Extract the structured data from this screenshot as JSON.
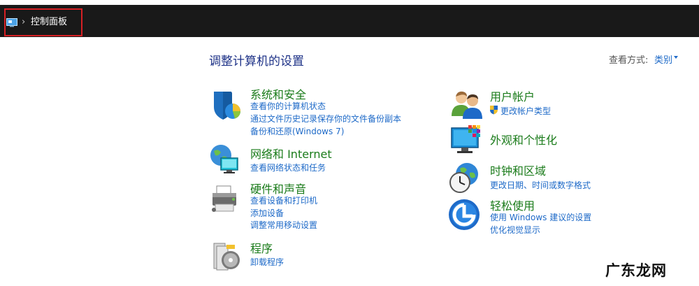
{
  "address_bar": {
    "breadcrumb": "控制面板",
    "separator": "›"
  },
  "header": {
    "title": "调整计算机的设置",
    "view_by_label": "查看方式:",
    "view_by_value": "类别"
  },
  "categories_left": [
    {
      "title": "系统和安全",
      "icon": "shield-icon",
      "links": [
        "查看你的计算机状态",
        "通过文件历史记录保存你的文件备份副本",
        "备份和还原(Windows 7)"
      ]
    },
    {
      "title": "网络和 Internet",
      "icon": "network-globe-icon",
      "links": [
        "查看网络状态和任务"
      ]
    },
    {
      "title": "硬件和声音",
      "icon": "printer-icon",
      "links": [
        "查看设备和打印机",
        "添加设备",
        "调整常用移动设置"
      ]
    },
    {
      "title": "程序",
      "icon": "programs-disc-icon",
      "links": [
        "卸载程序"
      ]
    }
  ],
  "categories_right": [
    {
      "title": "用户帐户",
      "icon": "users-icon",
      "links": [
        "更改帐户类型"
      ]
    },
    {
      "title": "外观和个性化",
      "icon": "monitor-palette-icon",
      "links": []
    },
    {
      "title": "时钟和区域",
      "icon": "clock-globe-icon",
      "links": [
        "更改日期、时间或数字格式"
      ]
    },
    {
      "title": "轻松使用",
      "icon": "ease-of-access-icon",
      "links": [
        "使用 Windows 建议的设置",
        "优化视觉显示"
      ]
    }
  ],
  "watermark": "广东龙网",
  "colors": {
    "address_bar_bg": "#191919",
    "category_title": "#1a7b1a",
    "link": "#1e6ac8",
    "page_title": "#1e3287",
    "highlight_border": "#d62024"
  }
}
